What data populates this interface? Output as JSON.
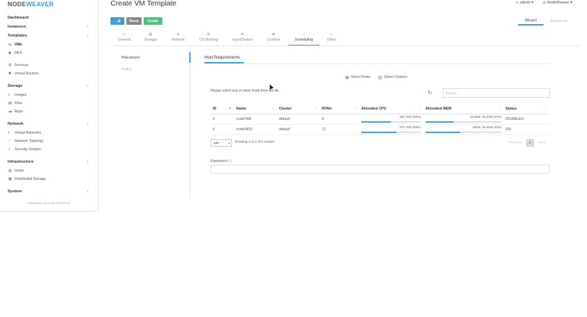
{
  "brand": {
    "part1": "NODE",
    "part2": "WEAVER"
  },
  "page": {
    "title": "Create VM Template"
  },
  "user": {
    "name": "admin",
    "zone": "NodeWeaver"
  },
  "toolbar": {
    "back_label": "←☰",
    "reset_label": "Reset",
    "create_label": "Create"
  },
  "mode": {
    "wizard": "Wizard",
    "advanced": "Advanced"
  },
  "sidebar": {
    "dashboard": "Dashboard",
    "instances": "Instances",
    "templates": "Templates",
    "vms": "VMs",
    "nes": "NES",
    "services": "Services",
    "virtual_routers": "Virtual Routers",
    "storage": "Storage",
    "images": "Images",
    "files": "Files",
    "apps": "Apps",
    "network": "Network",
    "virtual_networks": "Virtual Networks",
    "network_topology": "Network Topology",
    "security_groups": "Security Groups",
    "infrastructure": "Infrastructure",
    "hosts": "Hosts",
    "distributed_storage": "Distributed Storage",
    "system": "System",
    "version": "NodeWeaver 5.5.2 build 1802211212"
  },
  "tabs": [
    {
      "label": "General",
      "icon": "▭"
    },
    {
      "label": "Storage",
      "icon": "▤"
    },
    {
      "label": "Network",
      "icon": "●"
    },
    {
      "label": "OS Booting",
      "icon": "⚙"
    },
    {
      "label": "Input/Output",
      "icon": "⇄"
    },
    {
      "label": "Context",
      "icon": "■"
    },
    {
      "label": "Scheduling",
      "icon": "∴"
    },
    {
      "label": "Other",
      "icon": "—"
    }
  ],
  "subnav": {
    "placement": "Placement",
    "policy": "Policy"
  },
  "section": {
    "title": "Host Requirements"
  },
  "radio": {
    "hosts": "Select Hosts",
    "clusters": "Select Clusters"
  },
  "hint": "Please select one or more hosts from the list",
  "search": {
    "placeholder": "Search"
  },
  "table": {
    "headers": [
      "ID",
      "Name",
      "Cluster",
      "RVMs",
      "Allocated CPU",
      "Allocated MEM",
      "Status"
    ],
    "rows": [
      {
        "id": "1",
        "name": "node7fd6",
        "cluster": "default",
        "rvms": "8",
        "cpu": "400 / 800 (50%)",
        "cpu_pct": 50,
        "mem": "23.5GB / 62.9GB (37%)",
        "mem_pct": 37,
        "status": "DISABLED"
      },
      {
        "id": "0",
        "name": "node0452",
        "cluster": "default",
        "rvms": "12",
        "cpu": "470 / 800 (59%)",
        "cpu_pct": 59,
        "mem": "28GB / 62.9GB (45%)",
        "mem_pct": 45,
        "status": "ON"
      }
    ]
  },
  "paging": {
    "size": "100",
    "showing": "Showing 1 to 2 of 2 entries",
    "prev": "Previous",
    "page": "1",
    "next": "Next"
  },
  "expression": {
    "label": "Expression ⓘ"
  }
}
